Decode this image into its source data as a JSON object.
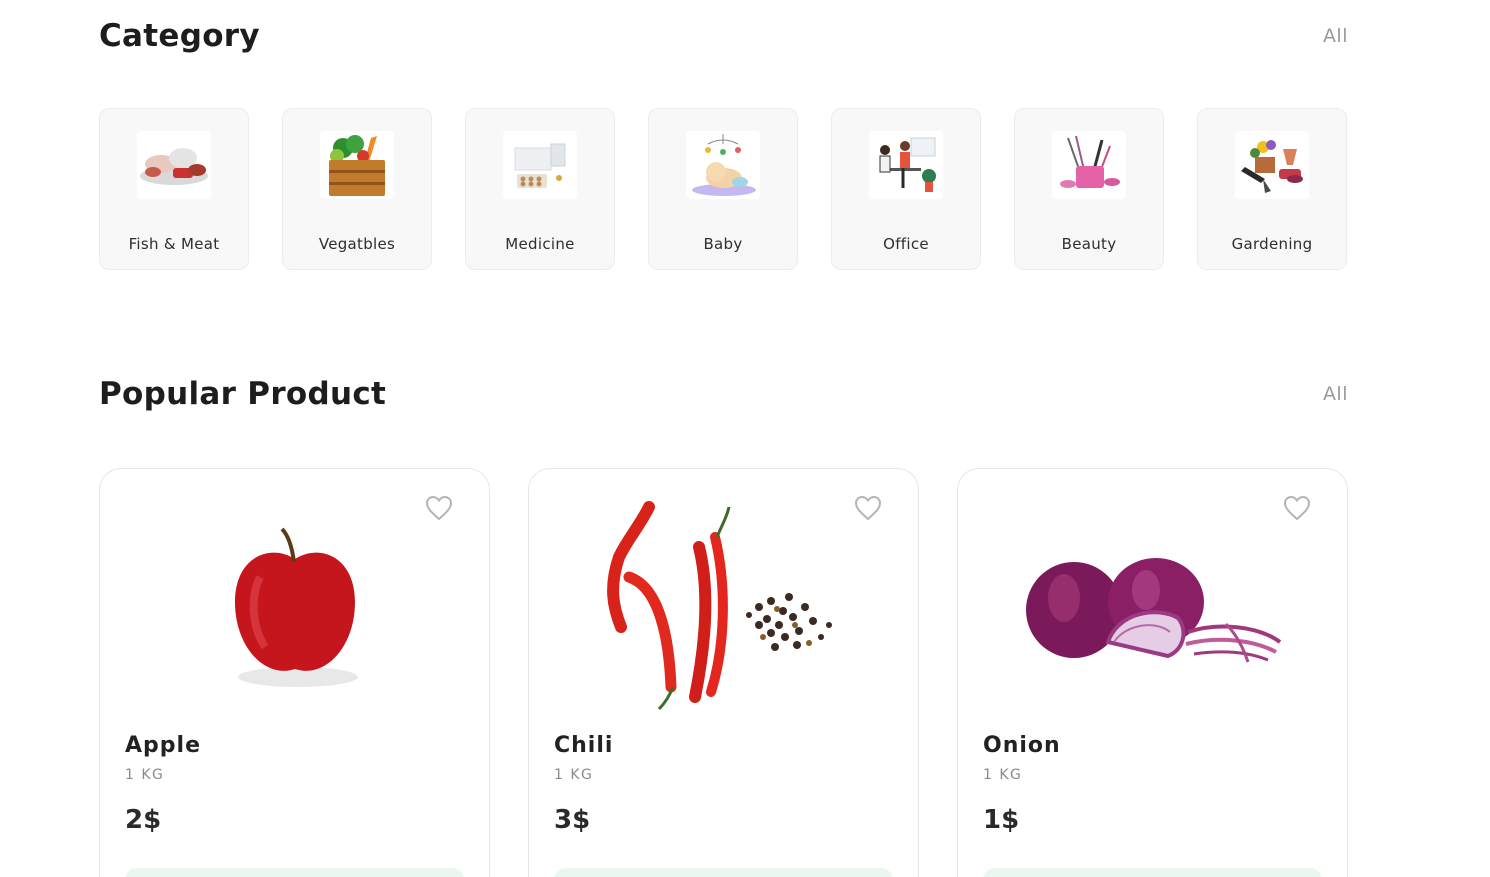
{
  "category": {
    "title": "Category",
    "all_label": "All",
    "items": [
      {
        "label": "Fish & Meat",
        "icon": "fish-meat-image"
      },
      {
        "label": "Vegatbles",
        "icon": "vegetable-crate-image"
      },
      {
        "label": "Medicine",
        "icon": "medicine-pack-image"
      },
      {
        "label": "Baby",
        "icon": "baby-image"
      },
      {
        "label": "Office",
        "icon": "office-image"
      },
      {
        "label": "Beauty",
        "icon": "beauty-kit-image"
      },
      {
        "label": "Gardening",
        "icon": "gardening-tools-image"
      }
    ]
  },
  "popular": {
    "title": "Popular Product",
    "all_label": "All",
    "products": [
      {
        "name": "Apple",
        "unit": "1 KG",
        "price": "2$",
        "image": "apple-image"
      },
      {
        "name": "Chili",
        "unit": "1 KG",
        "price": "3$",
        "image": "chili-image"
      },
      {
        "name": "Onion",
        "unit": "1 KG",
        "price": "1$",
        "image": "onion-image"
      }
    ]
  },
  "colors": {
    "card_bg": "#f8f8f8",
    "add_button_bg": "#e9f7ee",
    "muted_text": "#9a9a9a"
  }
}
